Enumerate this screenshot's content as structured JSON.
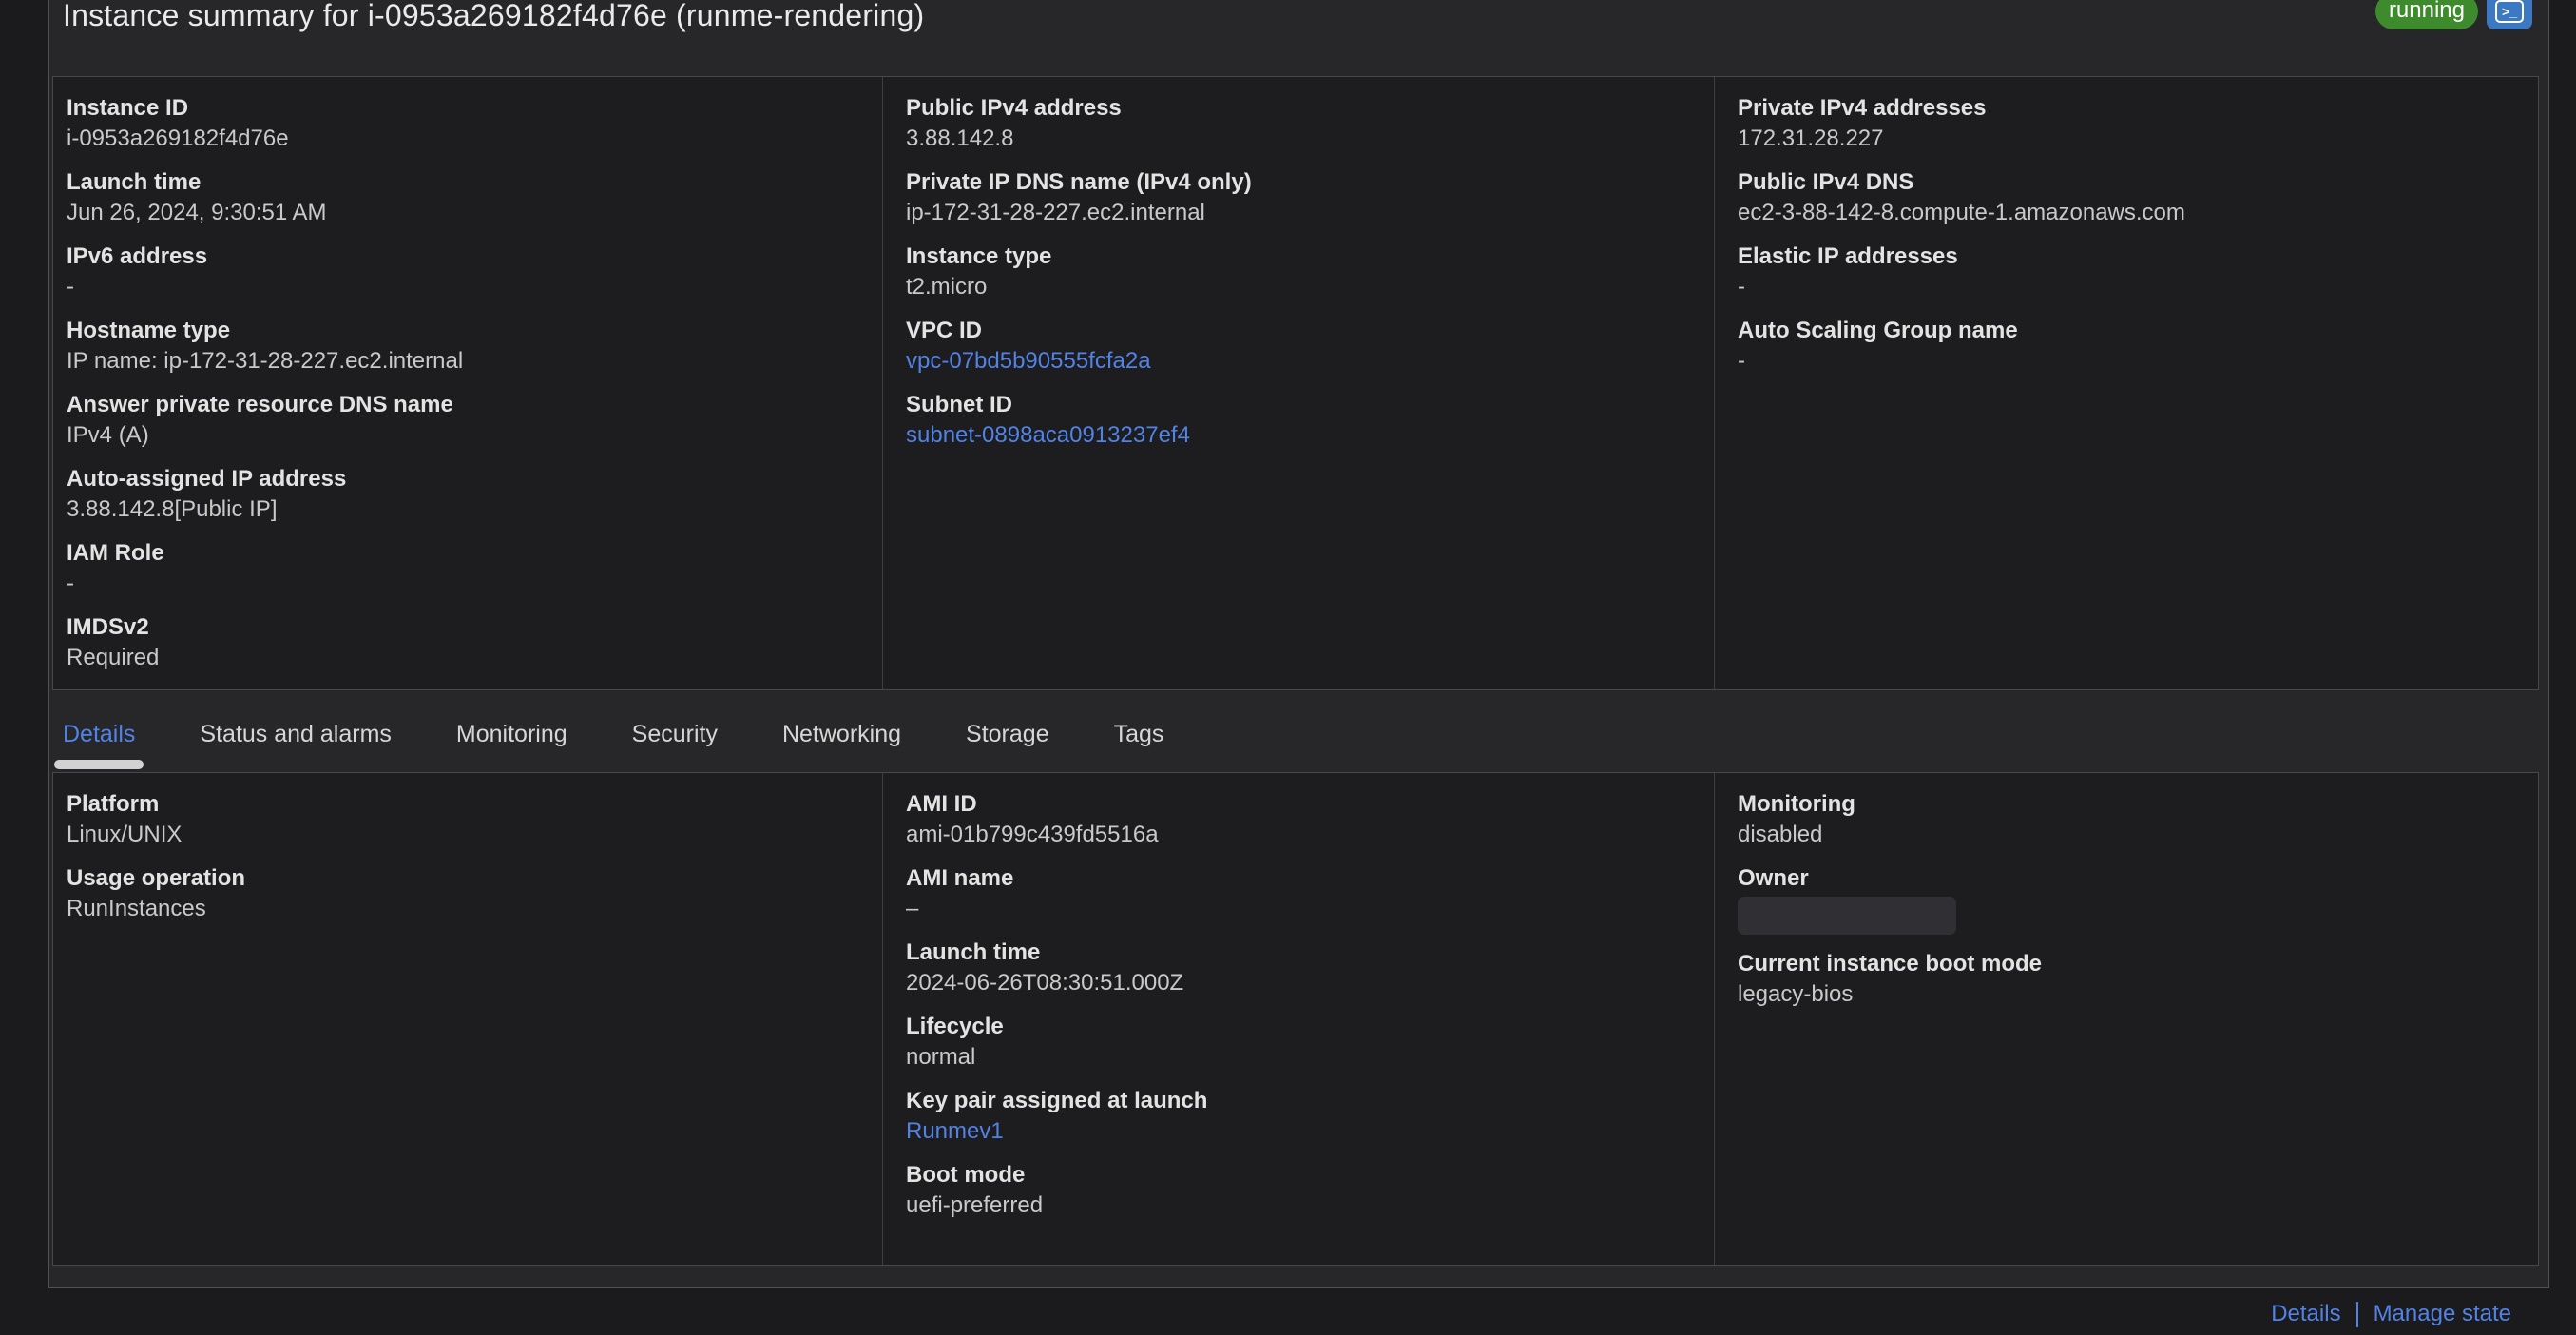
{
  "page": {
    "title": "Instance summary for i-0953a269182f4d76e (runme-rendering)"
  },
  "header": {
    "status_badge": "running",
    "console_icon": "console-terminal-icon"
  },
  "colors": {
    "accent_blue": "#5282e4",
    "status_green": "#3e8b2e",
    "console_icon_blue": "#3d79c2",
    "panel_bg": "#1d1d1f",
    "card_bg": "#27272a"
  },
  "summary": {
    "columns": [
      [
        {
          "label": "Instance ID",
          "value": "i-0953a269182f4d76e",
          "type": "text"
        },
        {
          "label": "Launch time",
          "value": "Jun 26, 2024, 9:30:51 AM",
          "type": "text"
        },
        {
          "label": "IPv6 address",
          "value": "-",
          "type": "text"
        },
        {
          "label": "Hostname type",
          "value": "IP name: ip-172-31-28-227.ec2.internal",
          "type": "text"
        },
        {
          "label": "Answer private resource DNS name",
          "value": "IPv4 (A)",
          "type": "text"
        },
        {
          "label": "Auto-assigned IP address",
          "value": "3.88.142.8[Public IP]",
          "type": "text"
        },
        {
          "label": "IAM Role",
          "value": "-",
          "type": "text"
        },
        {
          "label": "IMDSv2",
          "value": "Required",
          "type": "text"
        }
      ],
      [
        {
          "label": "Public IPv4 address",
          "value": "3.88.142.8",
          "type": "text"
        },
        {
          "label": "Private IP DNS name (IPv4 only)",
          "value": "ip-172-31-28-227.ec2.internal",
          "type": "text"
        },
        {
          "label": "Instance type",
          "value": "t2.micro",
          "type": "text"
        },
        {
          "label": "VPC ID",
          "value": "vpc-07bd5b90555fcfa2a",
          "type": "link"
        },
        {
          "label": "Subnet ID",
          "value": "subnet-0898aca0913237ef4",
          "type": "link"
        }
      ],
      [
        {
          "label": "Private IPv4 addresses",
          "value": "172.31.28.227",
          "type": "text"
        },
        {
          "label": "Public IPv4 DNS",
          "value": "ec2-3-88-142-8.compute-1.amazonaws.com",
          "type": "text"
        },
        {
          "label": "Elastic IP addresses",
          "value": "-",
          "type": "text"
        },
        {
          "label": "Auto Scaling Group name",
          "value": "-",
          "type": "text"
        }
      ]
    ]
  },
  "tabs": {
    "items": [
      {
        "label": "Details",
        "active": true
      },
      {
        "label": "Status and alarms",
        "active": false
      },
      {
        "label": "Monitoring",
        "active": false
      },
      {
        "label": "Security",
        "active": false
      },
      {
        "label": "Networking",
        "active": false
      },
      {
        "label": "Storage",
        "active": false
      },
      {
        "label": "Tags",
        "active": false
      }
    ]
  },
  "details": {
    "columns": [
      [
        {
          "label": "Platform",
          "value": "Linux/UNIX",
          "type": "text"
        },
        {
          "label": "Usage operation",
          "value": "RunInstances",
          "type": "text"
        }
      ],
      [
        {
          "label": "AMI ID",
          "value": "ami-01b799c439fd5516a",
          "type": "text"
        },
        {
          "label": "AMI name",
          "value": "–",
          "type": "text"
        },
        {
          "label": "Launch time",
          "value": "2024-06-26T08:30:51.000Z",
          "type": "text"
        },
        {
          "label": "Lifecycle",
          "value": "normal",
          "type": "text"
        },
        {
          "label": "Key pair assigned at launch",
          "value": "Runmev1",
          "type": "link"
        },
        {
          "label": "Boot mode",
          "value": "uefi-preferred",
          "type": "text"
        }
      ],
      [
        {
          "label": "Monitoring",
          "value": "disabled",
          "type": "text"
        },
        {
          "label": "Owner",
          "value": "",
          "type": "redacted"
        },
        {
          "label": "Current instance boot mode",
          "value": "legacy-bios",
          "type": "text"
        }
      ]
    ]
  },
  "footer": {
    "links": [
      "Details",
      "Manage state"
    ]
  }
}
